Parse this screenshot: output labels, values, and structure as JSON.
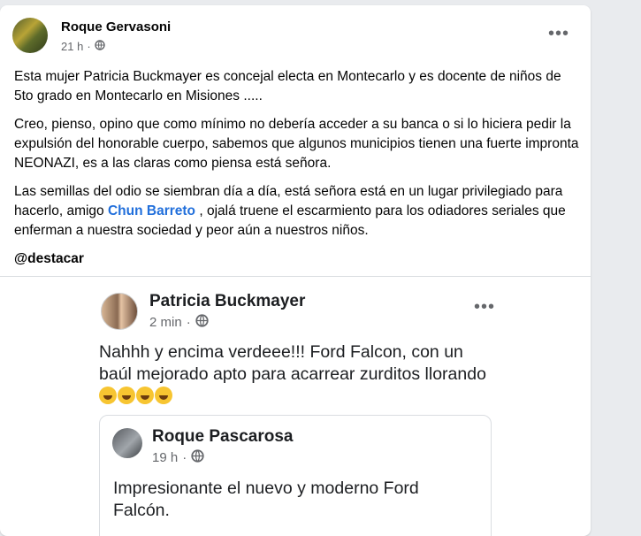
{
  "post": {
    "author": "Roque Gervasoni",
    "time": "21 h",
    "separator": "·",
    "paragraphs": {
      "p1": "Esta mujer Patricia Buckmayer es concejal electa en Montecarlo y es docente de niños de 5to grado en Montecarlo en Misiones .....",
      "p2": "Creo, pienso, opino que como mínimo no debería acceder a su banca o si lo hiciera pedir la expulsión del honorable cuerpo, sabemos que algunos municipios tienen una fuerte impronta NEONAZI, es a las claras como piensa está señora.",
      "p3_before": "Las semillas del odio se siembran día a día, está señora está en un lugar privilegiado para hacerlo, amigo ",
      "p3_mention": "Chun Barreto",
      "p3_after": " , ojalá truene el escarmiento para los odiadores seriales que enferman a nuestra sociedad y peor aún a nuestros niños.",
      "p4": "@destacar"
    },
    "more_label": "•••",
    "icons": {
      "more": "more-options-icon",
      "privacy": "globe-icon"
    }
  },
  "embedded": {
    "author": "Patricia Buckmayer",
    "time": "2 min",
    "separator": "·",
    "more_label": "•••",
    "text": "Nahhh y encima verdeee!!! Ford Falcon, con un baúl mejorado apto para acarrear zurditos llorando",
    "emoji_count": 4,
    "emoji_name": "rolling-on-floor-laughing-emoji",
    "shared": {
      "author": "Roque Pascarosa",
      "time": "19 h",
      "separator": "·",
      "text": "Impresionante el nuevo y moderno Ford Falcón."
    }
  },
  "colors": {
    "link": "#216fdb",
    "meta": "#65676b",
    "background": "#e9ebee"
  }
}
